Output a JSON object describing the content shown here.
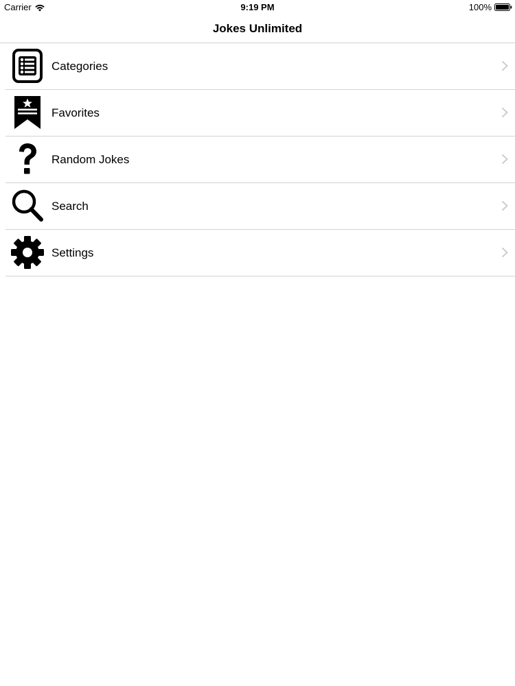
{
  "status_bar": {
    "carrier": "Carrier",
    "time": "9:19 PM",
    "battery": "100%"
  },
  "nav": {
    "title": "Jokes Unlimited"
  },
  "menu": {
    "items": [
      {
        "label": "Categories",
        "icon": "list-icon"
      },
      {
        "label": "Favorites",
        "icon": "bookmark-star-icon"
      },
      {
        "label": "Random Jokes",
        "icon": "question-mark-icon"
      },
      {
        "label": "Search",
        "icon": "search-icon"
      },
      {
        "label": "Settings",
        "icon": "gear-icon"
      }
    ]
  }
}
